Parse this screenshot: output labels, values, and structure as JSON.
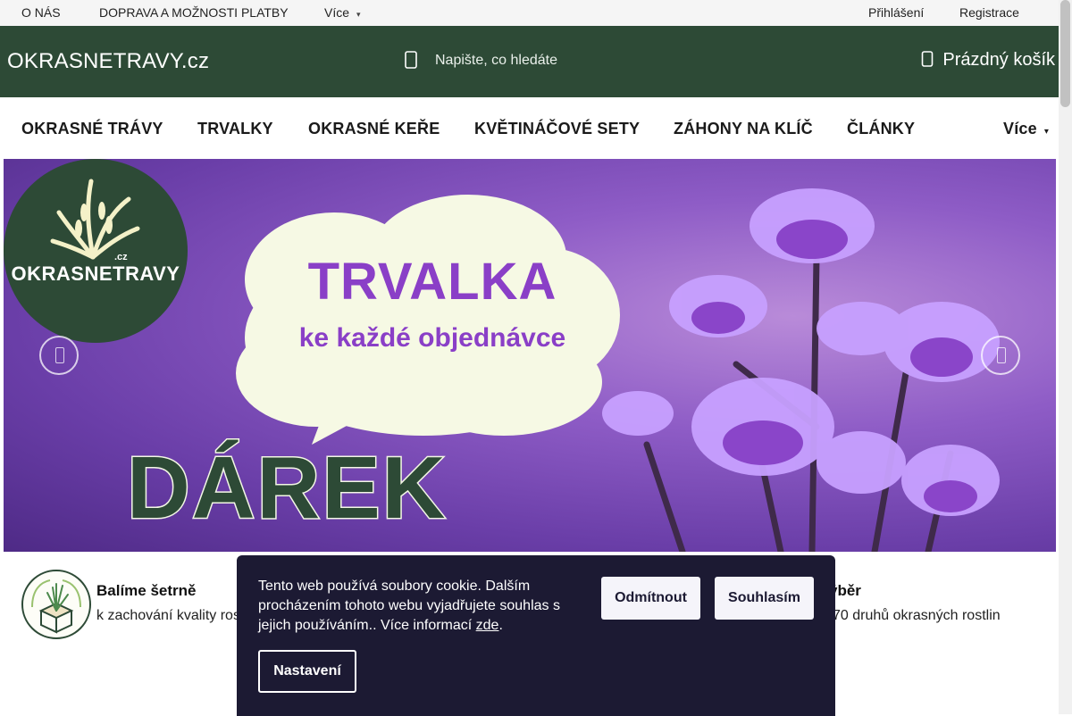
{
  "topbar": {
    "links": [
      "O NÁS",
      "DOPRAVA A MOŽNOSTI PLATBY",
      "Více"
    ],
    "account": [
      "Přihlášení",
      "Registrace"
    ]
  },
  "header": {
    "site_name": "OKRASNETRAVY.cz",
    "search_placeholder": "Napište, co hledáte",
    "cart_label": "Prázdný košík"
  },
  "nav": {
    "items": [
      "OKRASNÉ TRÁVY",
      "TRVALKY",
      "OKRASNÉ KEŘE",
      "KVĚTINÁČOVÉ SETY",
      "ZÁHONY NA KLÍČ",
      "ČLÁNKY"
    ],
    "more": "Více"
  },
  "hero": {
    "logo_word": "OKRASNETRAVY",
    "logo_cz": ".cz",
    "headline": "TRVALKA",
    "subline": "ke každé objednávce",
    "gift": "DÁREK"
  },
  "benefits": [
    {
      "title": "Balíme šetrně",
      "text": "k zachování kvality ros"
    },
    {
      "title": "ýběr",
      "text": "70 druhů okrasných rostlin"
    }
  ],
  "cookie": {
    "message": "Tento web používá soubory cookie. Dalším procházením tohoto webu vyjadřujete souhlas s jejich používáním.. Více informací ",
    "link": "zde",
    "tail": ".",
    "reject": "Odmítnout",
    "accept": "Souhlasím",
    "settings": "Nastavení"
  },
  "colors": {
    "brand_green": "#2d4a36",
    "cookie_bg": "#1c1a33",
    "headline_purple": "#8a3fc7"
  }
}
